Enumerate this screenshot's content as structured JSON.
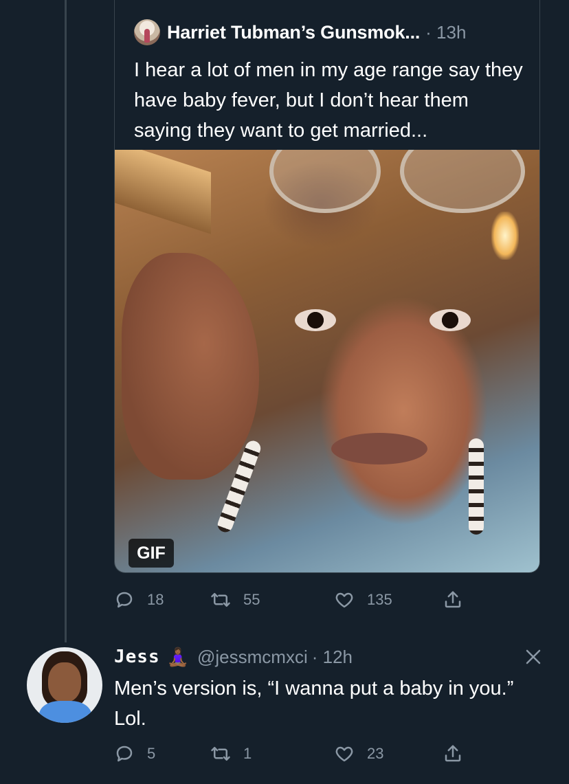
{
  "quoted_tweet": {
    "author_name": "Harriet Tubman’s Gunsmok...",
    "time": "· 13h",
    "text": "I hear a lot of men in my age range say they have baby fever, but I don’t hear them saying they want to get married...",
    "media_badge": "GIF"
  },
  "quoted_actions": {
    "replies": "18",
    "retweets": "55",
    "likes": "135"
  },
  "reply_tweet": {
    "author_name": "Jess",
    "emoji": "🧘🏾‍♀️",
    "handle": "@jessmcmxci",
    "time": "· 12h",
    "text": "Men’s version is, “I wanna put a baby in you.” Lol."
  },
  "reply_actions": {
    "replies": "5",
    "retweets": "1",
    "likes": "23"
  },
  "icons": [
    "reply-icon",
    "retweet-icon",
    "like-icon",
    "share-icon",
    "close-icon"
  ],
  "colors": {
    "background": "#15202b",
    "secondary_text": "#8b98a5",
    "border": "#38444d"
  }
}
